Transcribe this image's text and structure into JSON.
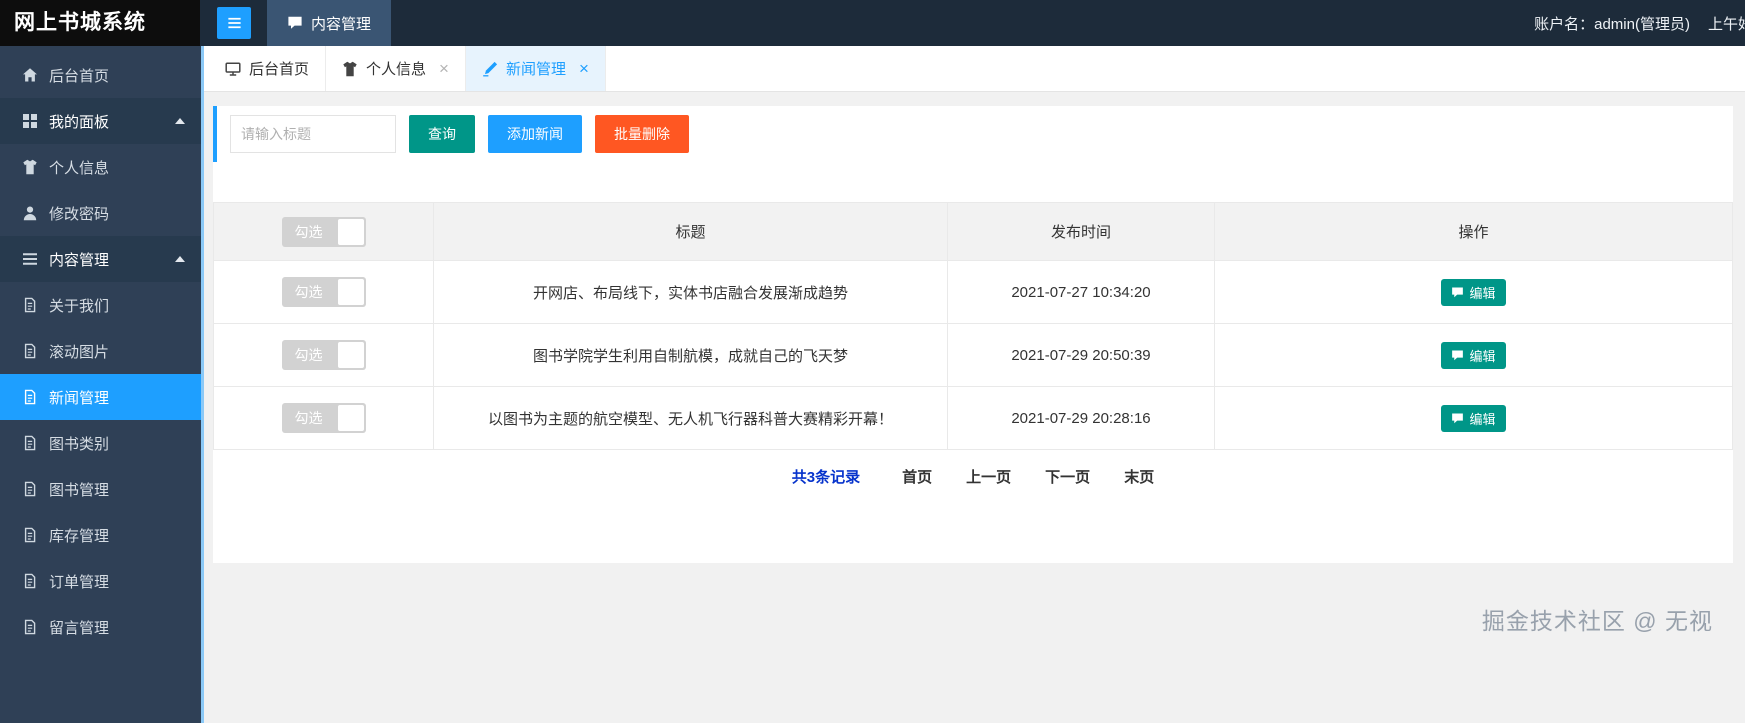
{
  "app": {
    "title": "网上书城系统"
  },
  "topbar": {
    "menu_item": "内容管理",
    "account_label": "账户名：admin(管理员)",
    "greeting": "上午好"
  },
  "sidebar": {
    "items": [
      {
        "label": "后台首页",
        "icon": "home-icon"
      },
      {
        "label": "我的面板",
        "icon": "panel-icon",
        "expanded": true
      },
      {
        "label": "个人信息",
        "icon": "shirt-icon"
      },
      {
        "label": "修改密码",
        "icon": "user-icon"
      },
      {
        "label": "内容管理",
        "icon": "content-icon",
        "expanded": true
      },
      {
        "label": "关于我们",
        "icon": "doc-icon"
      },
      {
        "label": "滚动图片",
        "icon": "doc-icon"
      },
      {
        "label": "新闻管理",
        "icon": "doc-icon",
        "active": true
      },
      {
        "label": "图书类别",
        "icon": "doc-icon"
      },
      {
        "label": "图书管理",
        "icon": "doc-icon"
      },
      {
        "label": "库存管理",
        "icon": "doc-icon"
      },
      {
        "label": "订单管理",
        "icon": "doc-icon"
      },
      {
        "label": "留言管理",
        "icon": "doc-icon"
      }
    ]
  },
  "tabs": [
    {
      "label": "后台首页",
      "icon": "monitor-icon",
      "closable": false
    },
    {
      "label": "个人信息",
      "icon": "shirt-icon",
      "closable": true
    },
    {
      "label": "新闻管理",
      "icon": "news-icon",
      "closable": true,
      "active": true
    }
  ],
  "toolbar": {
    "search_placeholder": "请输入标题",
    "query_button": "查询",
    "add_button": "添加新闻",
    "delete_button": "批量删除"
  },
  "table": {
    "switch_label": "勾选",
    "headers": [
      "标题",
      "发布时间",
      "操作"
    ],
    "edit_button": "编辑",
    "rows": [
      {
        "title": "开网店、布局线下，实体书店融合发展渐成趋势",
        "publish_time": "2021-07-27 10:34:20"
      },
      {
        "title": "图书学院学生利用自制航模，成就自己的飞天梦",
        "publish_time": "2021-07-29 20:50:39"
      },
      {
        "title": "以图书为主题的航空模型、无人机飞行器科普大赛精彩开幕！",
        "publish_time": "2021-07-29 20:28:16"
      }
    ]
  },
  "pagination": {
    "total": "共3条记录",
    "first": "首页",
    "prev": "上一页",
    "next": "下一页",
    "last": "末页"
  },
  "watermark": "掘金技术社区 @ 无视",
  "colors": {
    "accent": "#1E9FFF",
    "success": "#009688",
    "danger": "#FF5722",
    "sidebar_bg": "#2F4056",
    "topbar_bg": "#1D2B3A"
  }
}
